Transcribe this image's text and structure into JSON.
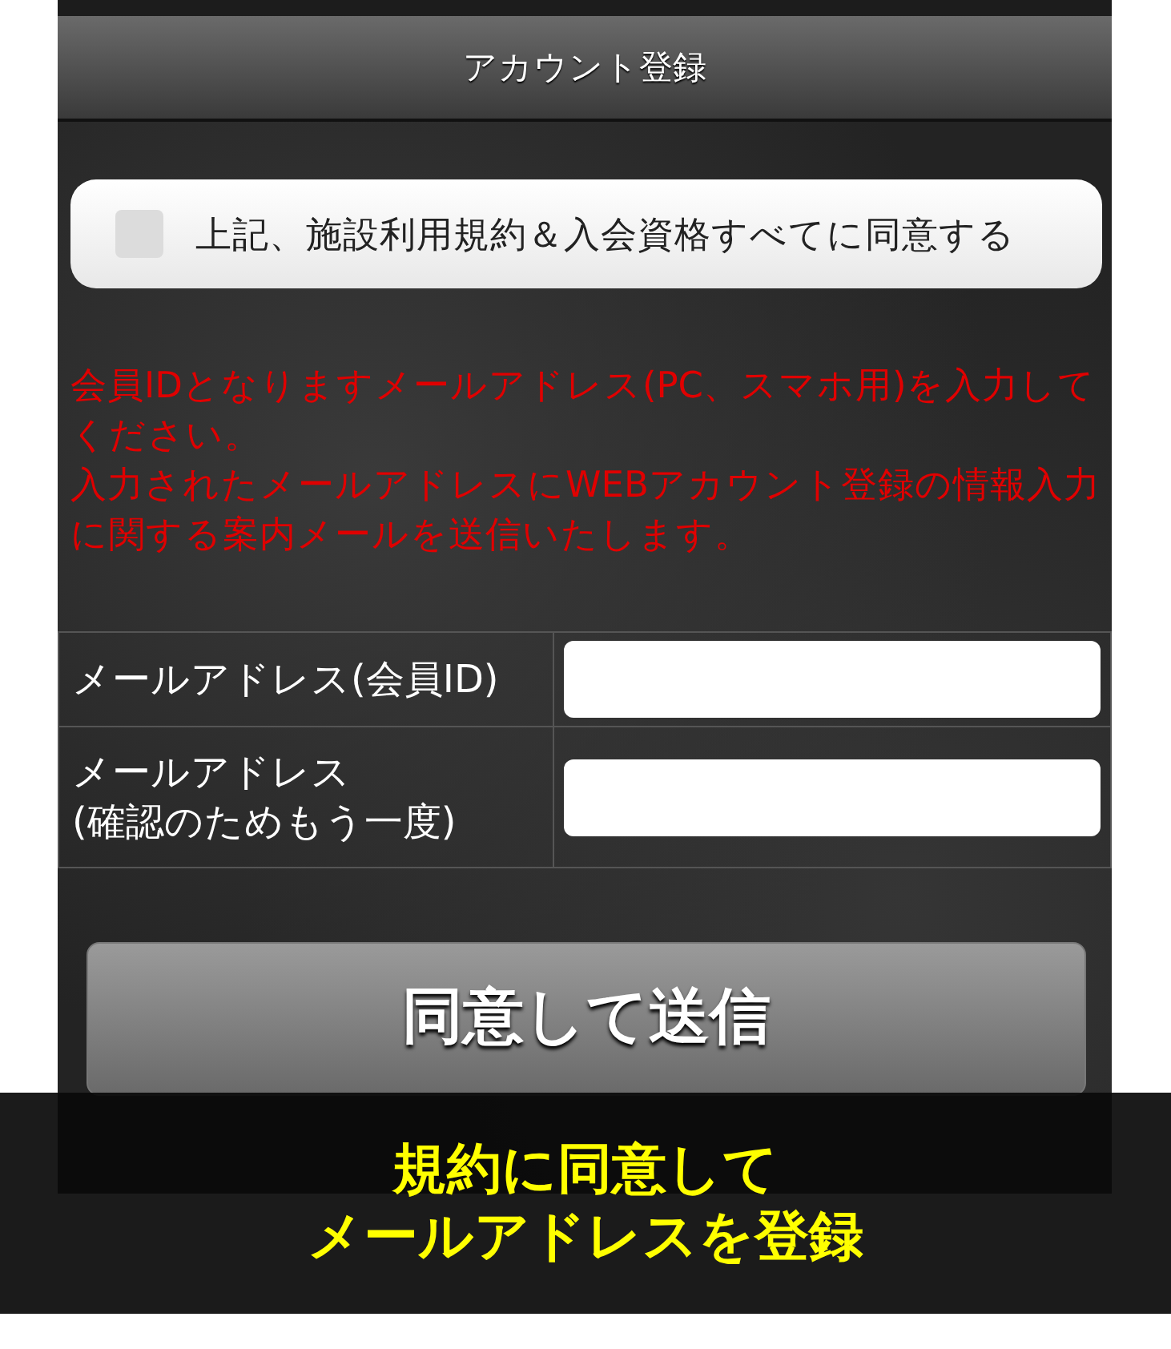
{
  "header": {
    "title": "アカウント登録"
  },
  "agreement": {
    "label": "上記、施設利用規約＆入会資格すべてに同意する",
    "checked": false
  },
  "notice": [
    "会員IDとなりますメールアドレス(PC、スマホ用)を入力してください。",
    "入力されたメールアドレスにWEBアカウント登録の情報入力に関する案内メールを送信いたします。"
  ],
  "form": {
    "rows": [
      {
        "label": "メールアドレス(会員ID)"
      },
      {
        "label": "メールアドレス\n(確認のためもう一度)"
      }
    ]
  },
  "submit_button": "同意して送信",
  "caption": [
    "規約に同意して",
    "メールアドレスを登録"
  ]
}
